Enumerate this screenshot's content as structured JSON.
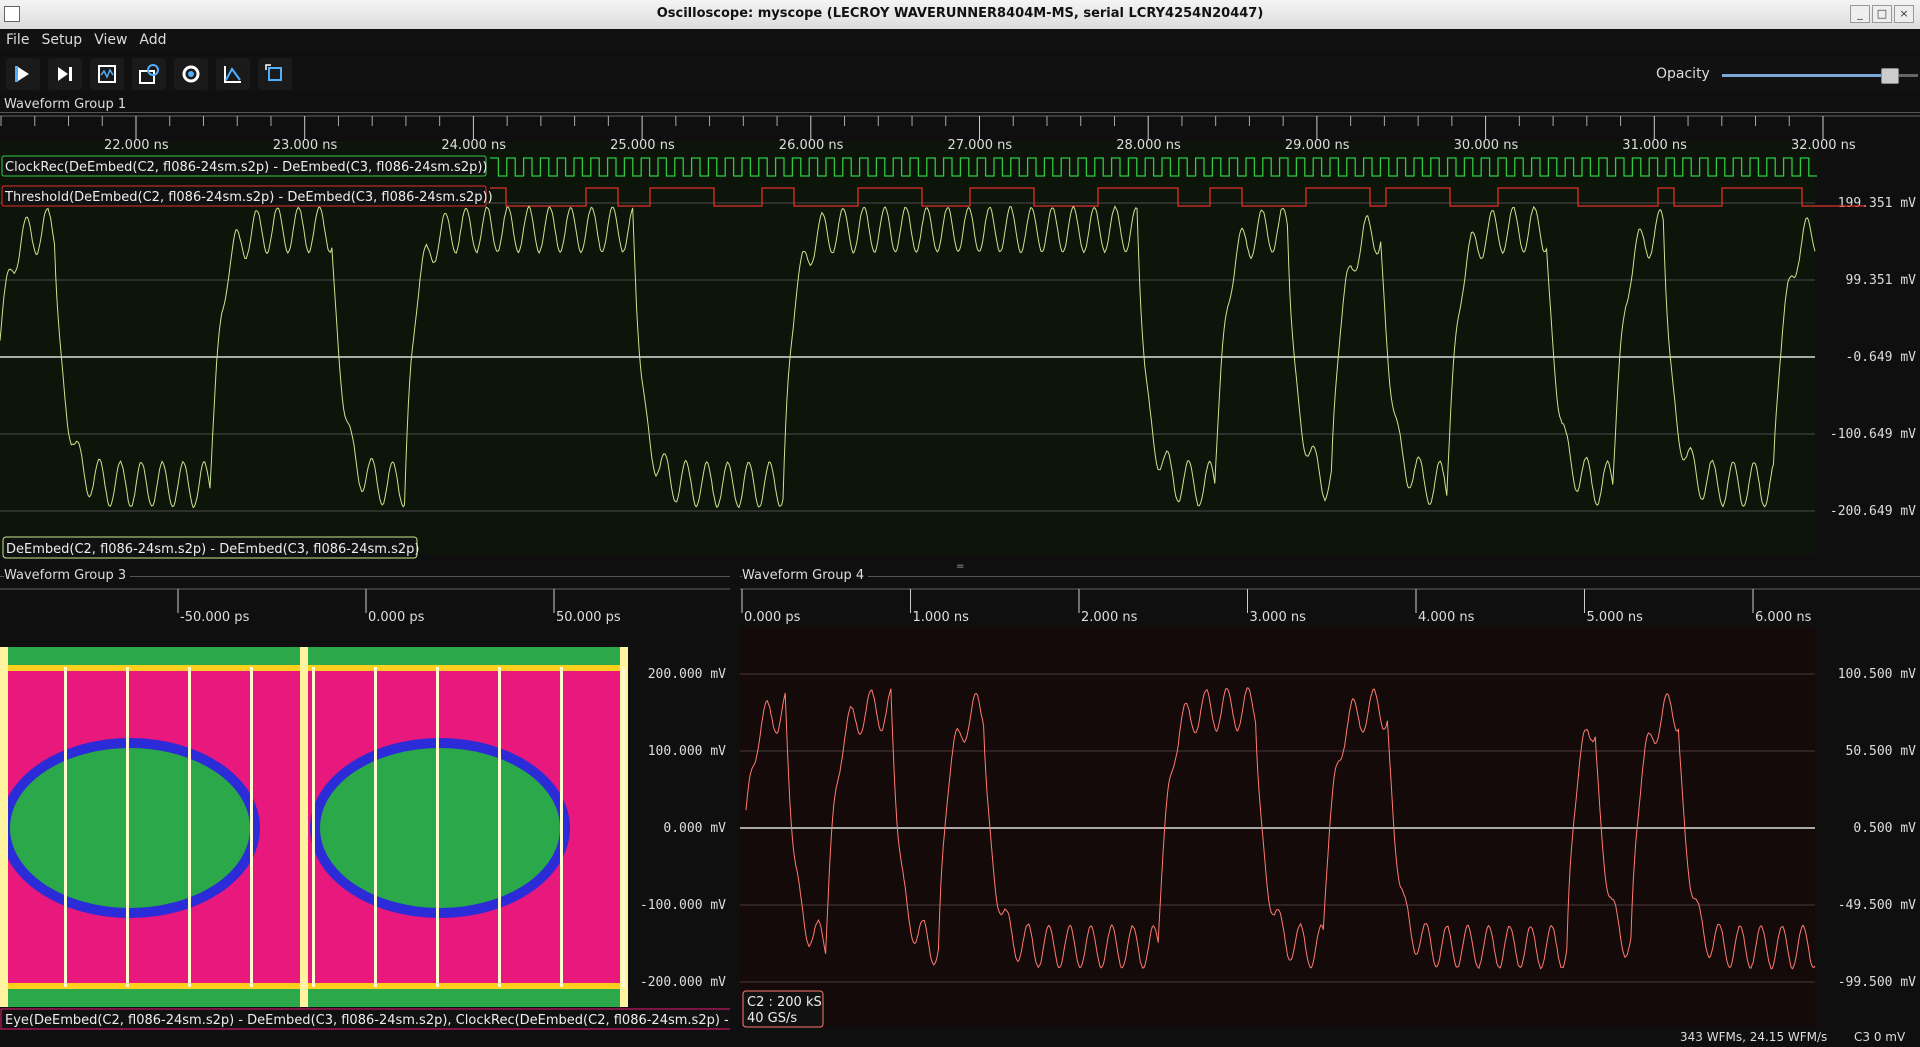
{
  "window": {
    "title": "Oscilloscope: myscope (LECROY WAVERUNNER8404M-MS, serial LCRY4254N20447)"
  },
  "menu": [
    "File",
    "Setup",
    "View",
    "Add"
  ],
  "toolbar": {
    "buttons": [
      "start-icon",
      "single-icon",
      "stop-icon",
      "history-icon",
      "refresh-icon",
      "autoscale-icon",
      "fullscreen-icon"
    ],
    "opacity_label": "Opacity",
    "opacity_value": 0.85
  },
  "groups": [
    {
      "title": "Waveform Group 1",
      "time_ticks": [
        "22.000 ns",
        "23.000 ns",
        "24.000 ns",
        "25.000 ns",
        "26.000 ns",
        "27.000 ns",
        "28.000 ns",
        "29.000 ns",
        "30.000 ns",
        "31.000 ns",
        "32.000 ns"
      ],
      "y_labels": [
        "199.351 mV",
        "99.351 mV",
        "-0.649 mV",
        "-100.649 mV",
        "-200.649 mV"
      ],
      "digital": [
        {
          "label": "ClockRec(DeEmbed(C2, fl086-24sm.s2p) - DeEmbed(C3, fl086-24sm.s2p))",
          "color": "#2ecc40"
        },
        {
          "label": "Threshold(DeEmbed(C2, fl086-24sm.s2p) - DeEmbed(C3, fl086-24sm.s2p))",
          "color": "#e0302a"
        }
      ],
      "trace_label": "DeEmbed(C2, fl086-24sm.s2p) - DeEmbed(C3, fl086-24sm.s2p)",
      "trace_color": "#c8e68c"
    },
    {
      "title": "Waveform Group 3",
      "time_ticks": [
        "-50.000 ps",
        "0.000 ps",
        "50.000 ps"
      ],
      "y_labels": [
        "200.000 mV",
        "100.000 mV",
        "0.000 mV",
        "-100.000 mV",
        "-200.000 mV"
      ],
      "trace_label": "Eye(DeEmbed(C2, fl086-24sm.s2p) - DeEmbed(C3, fl086-24sm.s2p), ClockRec(DeEmbed(C2, fl086-24sm.s2p) - ["
    },
    {
      "title": "Waveform Group 4",
      "time_ticks": [
        "0.000 ps",
        "1.000 ns",
        "2.000 ns",
        "3.000 ns",
        "4.000 ns",
        "5.000 ns",
        "6.000 ns"
      ],
      "y_labels": [
        "100.500 mV",
        "50.500 mV",
        "0.500 mV",
        "-49.500 mV",
        "-99.500 mV"
      ],
      "channel_info": {
        "line1": "C2 : 200 kS",
        "line2": "40 GS/s"
      },
      "trace_color": "#ff7a6e"
    }
  ],
  "status": {
    "rate": "343 WFMs, 24.15 WFM/s",
    "trigger": "C3 0 mV"
  }
}
